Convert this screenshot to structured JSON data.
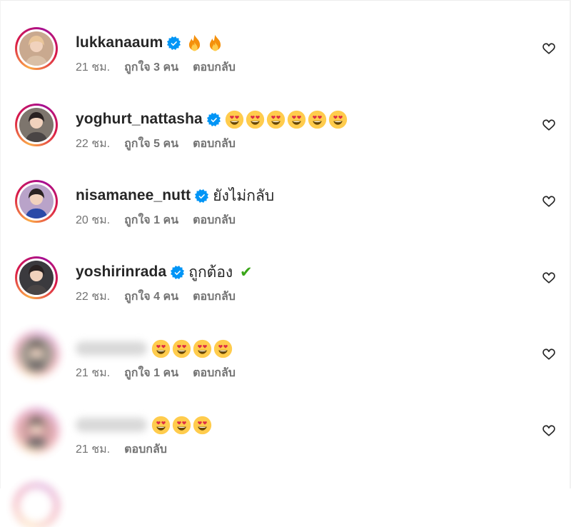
{
  "comments": [
    {
      "username": "lukkanaaum",
      "verified": true,
      "text": "",
      "emoji": [
        "🔥",
        "🔥"
      ],
      "time": "21 ชม.",
      "likes": "ถูกใจ 3 คน",
      "reply": "ตอบกลับ",
      "avatar_color": "#c9a98f"
    },
    {
      "username": "yoghurt_nattasha",
      "verified": true,
      "text": "",
      "emoji": [
        "😍",
        "😍",
        "😍",
        "😍",
        "😍",
        "😍"
      ],
      "time": "22 ชม.",
      "likes": "ถูกใจ 5 คน",
      "reply": "ตอบกลับ",
      "avatar_color": "#7d756d"
    },
    {
      "username": "nisamanee_nutt",
      "verified": true,
      "text": "ยังไม่กลับ",
      "emoji": [],
      "time": "20 ชม.",
      "likes": "ถูกใจ 1 คน",
      "reply": "ตอบกลับ",
      "avatar_color": "#b9a3c9"
    },
    {
      "username": "yoshirinrada",
      "verified": true,
      "text": "ถูกต้อง ✔",
      "emoji": [],
      "time": "22 ชม.",
      "likes": "ถูกใจ 4 คน",
      "reply": "ตอบกลับ",
      "avatar_color": "#3b3a3e"
    },
    {
      "username": "",
      "verified": false,
      "text": "",
      "emoji": [
        "😍",
        "😍",
        "😍",
        "😍"
      ],
      "time": "21 ชม.",
      "likes": "ถูกใจ 1 คน",
      "reply": "ตอบกลับ",
      "avatar_color": "#8f8478"
    },
    {
      "username": "",
      "verified": false,
      "text": "",
      "emoji": [
        "😍",
        "😍",
        "😍"
      ],
      "time": "21 ชม.",
      "likes": "",
      "reply": "ตอบกลับ",
      "avatar_color": "#c98c8f"
    }
  ],
  "colors": {
    "primary_text": "#262626",
    "secondary_text": "#737373",
    "verified_blue": "#0095f6"
  },
  "icons": {
    "verified": "verified-badge-icon",
    "like": "heart-outline-icon"
  }
}
